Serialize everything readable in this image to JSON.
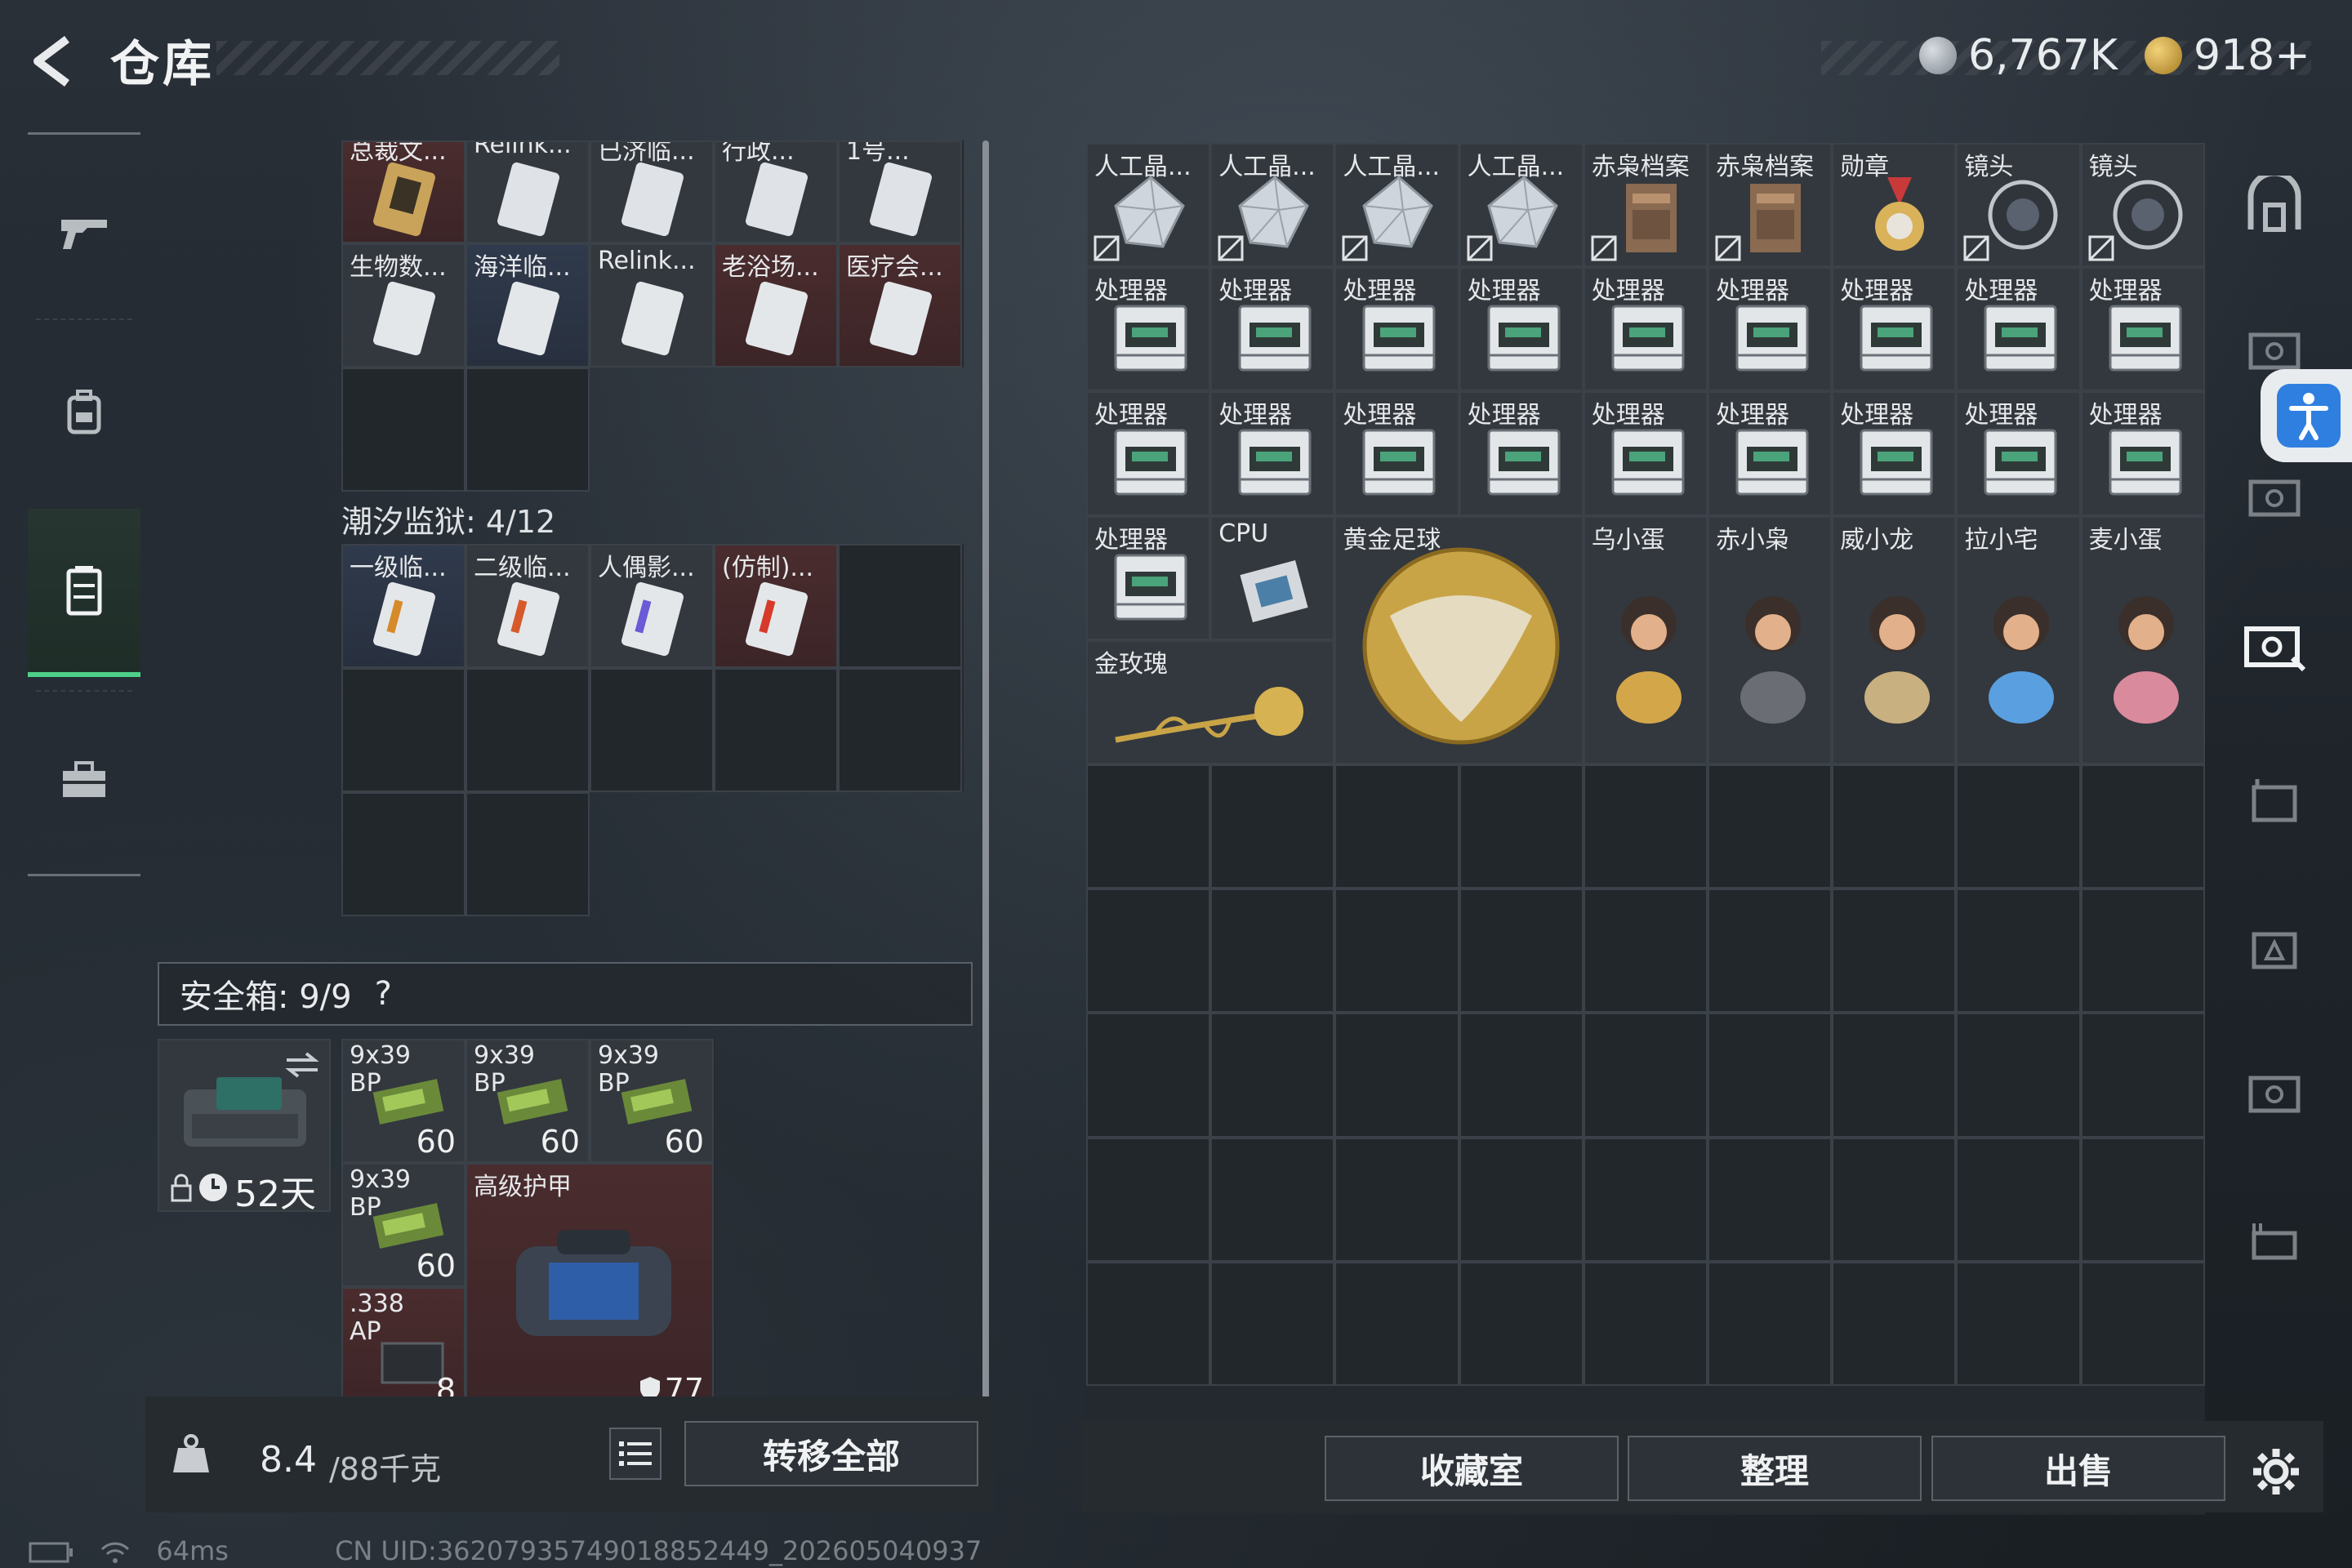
{
  "header": {
    "title": "仓库",
    "currency1": "6,767K",
    "currency2": "918+"
  },
  "left_nav": [
    "weapon-tab",
    "backpack-tab",
    "locker-tab",
    "toolbox-tab"
  ],
  "left_panel": {
    "top_items_row1": [
      "总裁文...",
      "Relink...",
      "已济临...",
      "行政...",
      "1号..."
    ],
    "top_items_row2": [
      "生物数...",
      "海洋临...",
      "Relink...",
      "老浴场...",
      "医疗会..."
    ],
    "tide_section_label": "潮汐监狱: 4/12",
    "tide_items": [
      "一级临...",
      "二级临...",
      "人偶影...",
      "(仿制)..."
    ],
    "safe_box_label": "安全箱: 9/9",
    "safe_box_help": "?",
    "safe_box_days": "52天",
    "ammo": [
      {
        "name": "9x39\nBP",
        "count": "60"
      },
      {
        "name": "9x39\nBP",
        "count": "60"
      },
      {
        "name": "9x39\nBP",
        "count": "60"
      },
      {
        "name": "9x39\nBP",
        "count": "60"
      }
    ],
    "ammo_338": {
      "name": ".338\nAP",
      "count": "8"
    },
    "armor": {
      "name": "高级护甲",
      "durability": "77"
    },
    "weight": "8.4",
    "weight_max": "/88千克",
    "transfer_all": "转移全部"
  },
  "right_panel": {
    "row1": [
      "人工晶...",
      "人工晶...",
      "人工晶...",
      "人工晶...",
      "赤枭档案",
      "赤枭档案",
      "勋章",
      "镜头",
      "镜头"
    ],
    "processor_label": "处理器",
    "row4_extra": [
      "CPU",
      "黄金足球",
      "乌小蛋",
      "赤小枭",
      "威小龙",
      "拉小宅",
      "麦小蛋"
    ],
    "rose": "金玫瑰",
    "buttons": {
      "collection": "收藏室",
      "sort": "整理",
      "sell": "出售"
    }
  },
  "status_bar": {
    "ping": "64ms",
    "uid": "CN UID:36207935749018852449_202605040937"
  },
  "colors": {
    "accent_green": "#4fd08a",
    "accessibility_blue": "#2f7fe0"
  }
}
